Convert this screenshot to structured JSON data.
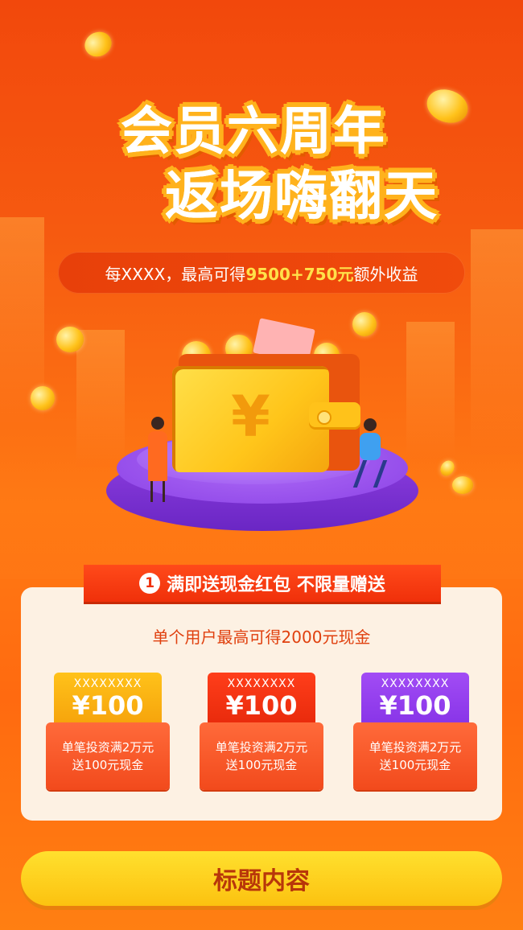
{
  "headline": {
    "line1": "会员六周年",
    "line2": "返场嗨翻天"
  },
  "promo_pill": {
    "prefix": "每XXXX，最高可得",
    "highlight": "9500+750元",
    "suffix": "额外收益"
  },
  "illustration": {
    "currency_symbol": "¥"
  },
  "section1": {
    "number": "1",
    "title": "满即送现金红包 不限量赠送",
    "subtitle": "单个用户最高可得2000元现金"
  },
  "coupons": [
    {
      "code": "XXXXXXXX",
      "amount": "¥100",
      "line1": "单笔投资满2万元",
      "line2": "送100元现金",
      "color": "#ffc21a"
    },
    {
      "code": "XXXXXXXX",
      "amount": "¥100",
      "line1": "单笔投资满2万元",
      "line2": "送100元现金",
      "color": "#ff3e1a"
    },
    {
      "code": "XXXXXXXX",
      "amount": "¥100",
      "line1": "单笔投资满2万元",
      "line2": "送100元现金",
      "color": "#a24cf5"
    }
  ],
  "cta": {
    "label": "标题内容"
  },
  "colors": {
    "background": "#f65a10",
    "accent_yellow": "#ffe14a",
    "card_bg": "#fdf1e3",
    "button": "#fcc210"
  }
}
